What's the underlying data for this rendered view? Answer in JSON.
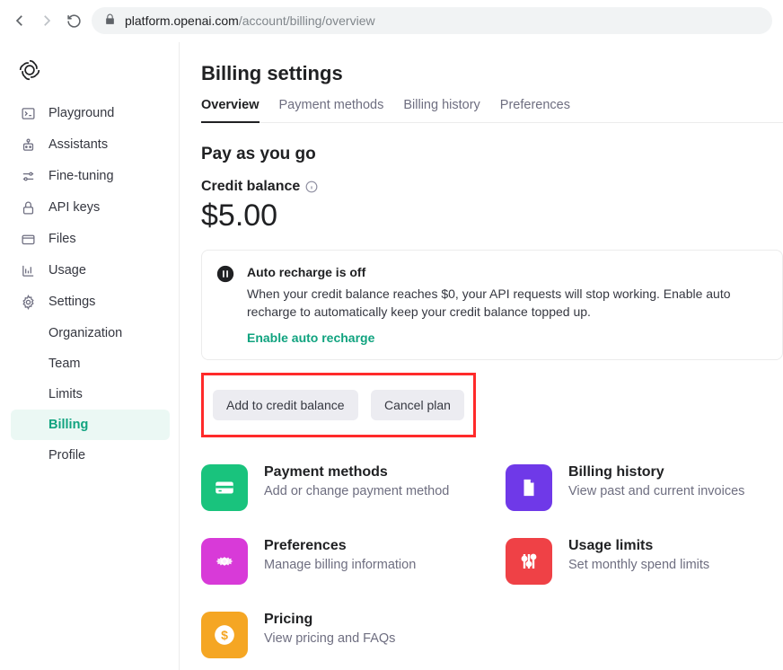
{
  "browser": {
    "url_host": "platform.openai.com",
    "url_path": "/account/billing/overview"
  },
  "sidebar": {
    "items": [
      {
        "icon": "terminal",
        "label": "Playground"
      },
      {
        "icon": "robot",
        "label": "Assistants"
      },
      {
        "icon": "sliders",
        "label": "Fine-tuning"
      },
      {
        "icon": "lock",
        "label": "API keys"
      },
      {
        "icon": "folder",
        "label": "Files"
      },
      {
        "icon": "chart",
        "label": "Usage"
      },
      {
        "icon": "gear",
        "label": "Settings"
      }
    ],
    "subitems": [
      {
        "label": "Organization",
        "active": false
      },
      {
        "label": "Team",
        "active": false
      },
      {
        "label": "Limits",
        "active": false
      },
      {
        "label": "Billing",
        "active": true
      },
      {
        "label": "Profile",
        "active": false
      }
    ]
  },
  "page": {
    "title": "Billing settings",
    "tabs": [
      {
        "label": "Overview",
        "active": true
      },
      {
        "label": "Payment methods",
        "active": false
      },
      {
        "label": "Billing history",
        "active": false
      },
      {
        "label": "Preferences",
        "active": false
      }
    ],
    "section_title": "Pay as you go",
    "balance_label": "Credit balance",
    "balance_amount": "$5.00",
    "callout": {
      "title": "Auto recharge is off",
      "text": "When your credit balance reaches $0, your API requests will stop working. Enable auto recharge to automatically keep your credit balance topped up.",
      "link": "Enable auto recharge"
    },
    "buttons": {
      "add": "Add to credit balance",
      "cancel": "Cancel plan"
    },
    "cards": [
      {
        "icon": "card",
        "color": "c-green",
        "title": "Payment methods",
        "desc": "Add or change payment method"
      },
      {
        "icon": "doc",
        "color": "c-purple",
        "title": "Billing history",
        "desc": "View past and current invoices"
      },
      {
        "icon": "gear-w",
        "color": "c-pink",
        "title": "Preferences",
        "desc": "Manage billing information"
      },
      {
        "icon": "sliders-w",
        "color": "c-red",
        "title": "Usage limits",
        "desc": "Set monthly spend limits"
      },
      {
        "icon": "dollar",
        "color": "c-orange",
        "title": "Pricing",
        "desc": "View pricing and FAQs"
      }
    ]
  }
}
